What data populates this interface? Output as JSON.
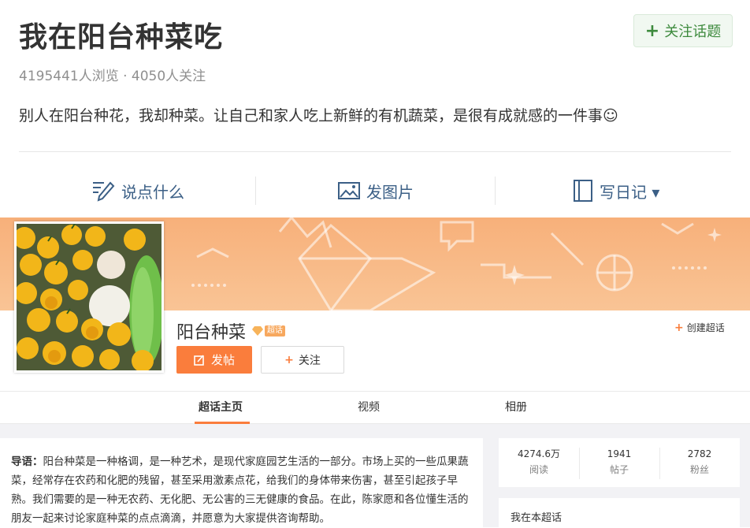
{
  "topic": {
    "title": "我在阳台种菜吃",
    "stats": "4195441人浏览 · 4050人关注",
    "description": "别人在阳台种花，我却种菜。让自己和家人吃上新鲜的有机蔬菜，是很有成就感的一件事☺",
    "follow_label": "关注话题"
  },
  "actions": {
    "say": "说点什么",
    "photo": "发图片",
    "diary": "写日记 ▾"
  },
  "super_topic": {
    "name": "阳台种菜",
    "badge": "超话",
    "post_label": "发帖",
    "follow_label": "关注",
    "create_label": "创建超话"
  },
  "tabs": [
    "超话主页",
    "视频",
    "相册"
  ],
  "intro": {
    "label": "导语：",
    "text": "阳台种菜是一种格调，是一种艺术，是现代家庭园艺生活的一部分。市场上买的一些瓜果蔬菜，经常存在农药和化肥的残留，甚至采用激素点花，给我们的身体带来伤害，甚至引起孩子早熟。我们需要的是一种无农药、无化肥、无公害的三无健康的食品。在此，陈家愿和各位懂生活的朋友一起来讨论家庭种菜的点点滴滴，并愿意为大家提供咨询帮助。"
  },
  "stats": [
    {
      "value": "4274.6万",
      "label": "阅读"
    },
    {
      "value": "1941",
      "label": "帖子"
    },
    {
      "value": "2782",
      "label": "粉丝"
    }
  ],
  "my_card_title": "我在本超话",
  "colors": {
    "accent": "#fa7d3c",
    "link": "#3b5f86",
    "follow_green": "#3d8a3d"
  }
}
